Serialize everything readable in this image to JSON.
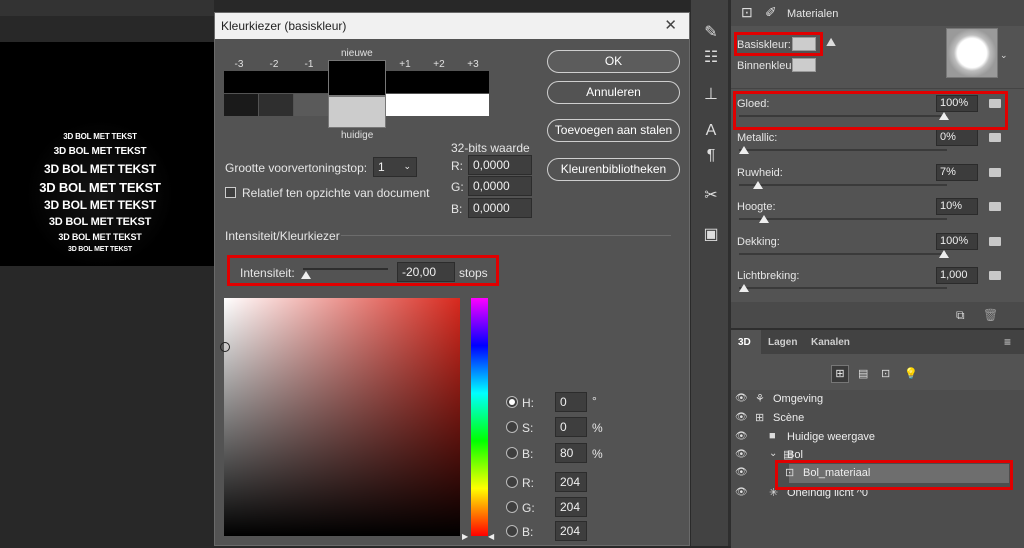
{
  "canvas": {
    "sphere_text": "3D BOL MET TEKST"
  },
  "dialog": {
    "title": "Kleurkiezer (basiskleur)",
    "close": "✕",
    "stops": [
      "-3",
      "-2",
      "-1",
      "+1",
      "+2",
      "+3"
    ],
    "new_label": "nieuwe",
    "current_label": "huidige",
    "buttons": {
      "ok": "OK",
      "cancel": "Annuleren",
      "add_swatches": "Toevoegen aan stalen",
      "libraries": "Kleurenbibliotheken"
    },
    "preview_size_label": "Grootte voorvertoningstop:",
    "preview_size_value": "1",
    "relative_label": "Relatief ten opzichte van document",
    "bit32_label": "32-bits waarde",
    "r_label": "R:",
    "g_label": "G:",
    "b_label": "B:",
    "r32": "0,0000",
    "g32": "0,0000",
    "b32": "0,0000",
    "section_label": "Intensiteit/Kleurkiezer",
    "intensity_label": "Intensiteit:",
    "intensity_value": "-20,00",
    "intensity_unit": "stops",
    "h_label": "H:",
    "h_value": "0",
    "h_unit": "°",
    "s_label": "S:",
    "s_value": "0",
    "s_unit": "%",
    "bb_label": "B:",
    "bb_value": "80",
    "bb_unit": "%",
    "rr_label": "R:",
    "rr_value": "204",
    "gg_label": "G:",
    "gg_value": "204",
    "b2_label": "B:",
    "b2_value": "204"
  },
  "props": {
    "header": "Materialen",
    "basiskleur": "Basiskleur:",
    "binnenkleur": "Binnenkleur:",
    "rows": [
      {
        "label": "Gloed:",
        "value": "100%",
        "level": 1.0
      },
      {
        "label": "Metallic:",
        "value": "0%",
        "level": 0.0
      },
      {
        "label": "Ruwheid:",
        "value": "7%",
        "level": 0.07
      },
      {
        "label": "Hoogte:",
        "value": "10%",
        "level": 0.1
      },
      {
        "label": "Dekking:",
        "value": "100%",
        "level": 1.0
      },
      {
        "label": "Lichtbreking:",
        "value": "1,000",
        "level": 0.0
      }
    ]
  },
  "layers": {
    "tabs": [
      "3D",
      "Lagen",
      "Kanalen"
    ],
    "items": [
      "Omgeving",
      "Scène",
      "Huidige weergave",
      "Bol",
      "Bol_materiaal",
      "Oneindig licht ^0"
    ]
  },
  "colors": {
    "accent_red": "#e00000",
    "base_color": "#cccccc"
  }
}
